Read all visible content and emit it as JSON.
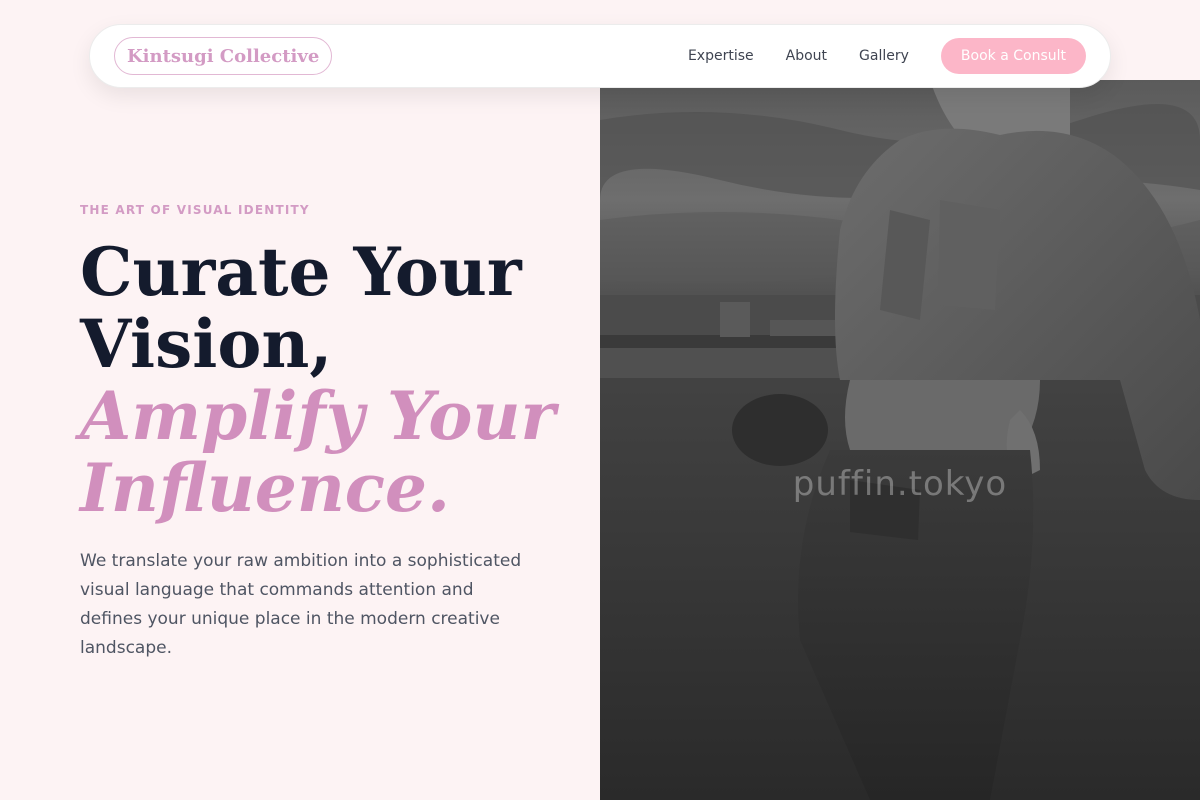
{
  "nav": {
    "logo": "Kintsugi Collective",
    "links": [
      "Expertise",
      "About",
      "Gallery"
    ],
    "cta": "Book a Consult"
  },
  "hero": {
    "eyebrow": "THE ART OF VISUAL IDENTITY",
    "headline_dark_1": "Curate Your",
    "headline_dark_2": "Vision,",
    "headline_accent_1": "Amplify Your",
    "headline_accent_2": "Influence.",
    "lead": "We translate your raw ambition into a sophisticated visual language that commands attention and defines your unique place in the modern creative landscape.",
    "image_watermark": "puffin.tokyo"
  },
  "colors": {
    "background": "#fdf3f4",
    "accent": "#d18fbd",
    "cta": "#fcb6c8",
    "heading": "#141b2d"
  }
}
